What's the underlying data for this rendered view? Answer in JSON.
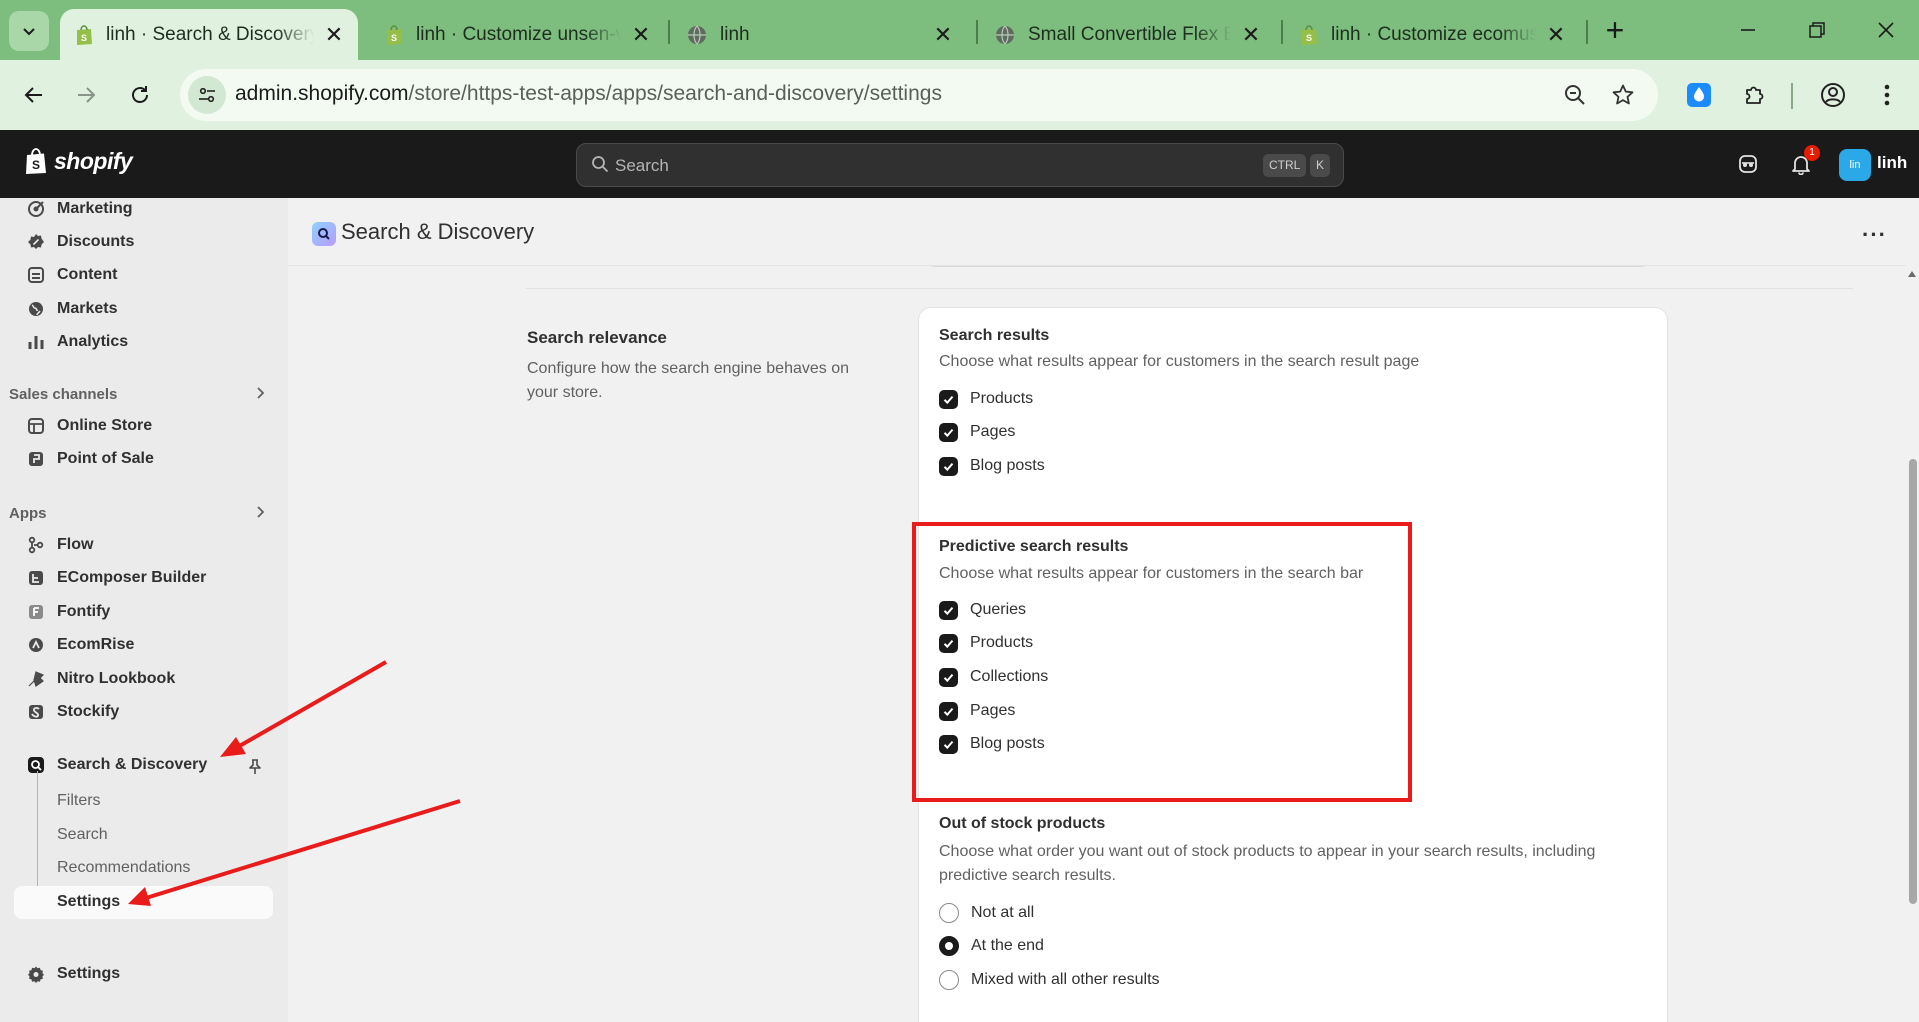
{
  "browser": {
    "tabs": [
      {
        "title": "linh · Search & Discovery",
        "icon": "shopify-bag-icon",
        "active": true
      },
      {
        "title": "linh · Customize unsen-v",
        "icon": "shopify-bag-icon",
        "active": false
      },
      {
        "title": "linh",
        "icon": "globe-icon",
        "active": false
      },
      {
        "title": "Small Convertible Flex Ba",
        "icon": "globe-icon",
        "active": false
      },
      {
        "title": "linh · Customize ecomus-",
        "icon": "shopify-bag-icon",
        "active": false
      }
    ],
    "close_glyph": "✕",
    "new_tab_glyph": "+",
    "url_host": "admin.shopify.com",
    "url_path": "/store/https-test-apps/apps/search-and-discovery/settings"
  },
  "shopify": {
    "logo_text": "shopify",
    "search_placeholder": "Search",
    "shortcut_keys": [
      "CTRL",
      "K"
    ],
    "notification_count": "1",
    "avatar_initials": "lin",
    "user_name": "linh"
  },
  "sidebar": {
    "top_items": [
      {
        "label": "Marketing",
        "icon": "marketing-target-icon"
      },
      {
        "label": "Discounts",
        "icon": "discount-badge-icon"
      },
      {
        "label": "Content",
        "icon": "content-image-icon"
      },
      {
        "label": "Markets",
        "icon": "globe-markets-icon"
      },
      {
        "label": "Analytics",
        "icon": "bar-chart-icon"
      }
    ],
    "sales_channels_heading": "Sales channels",
    "sales_channels": [
      {
        "label": "Online Store",
        "icon": "store-icon"
      },
      {
        "label": "Point of Sale",
        "icon": "pos-bag-icon"
      }
    ],
    "apps_heading": "Apps",
    "apps": [
      {
        "label": "Flow",
        "icon": "flow-app-icon"
      },
      {
        "label": "EComposer Builder",
        "icon": "ecomposer-app-icon"
      },
      {
        "label": "Fontify",
        "icon": "fontify-app-icon"
      },
      {
        "label": "EcomRise",
        "icon": "ecomrise-app-icon"
      },
      {
        "label": "Nitro Lookbook",
        "icon": "nitro-app-icon"
      },
      {
        "label": "Stockify",
        "icon": "stockify-app-icon"
      }
    ],
    "active_app": "Search & Discovery",
    "sub_items": [
      "Filters",
      "Search",
      "Recommendations",
      "Settings"
    ],
    "bottom_settings": "Settings"
  },
  "page": {
    "title": "Search & Discovery",
    "more_glyph": "···",
    "section_title": "Search relevance",
    "section_desc": "Configure how the search engine behaves on your store.",
    "search_results": {
      "title": "Search results",
      "desc": "Choose what results appear for customers in the search result page",
      "options": [
        {
          "label": "Products",
          "checked": true
        },
        {
          "label": "Pages",
          "checked": true
        },
        {
          "label": "Blog posts",
          "checked": true
        }
      ]
    },
    "predictive": {
      "title": "Predictive search results",
      "desc": "Choose what results appear for customers in the search bar",
      "options": [
        {
          "label": "Queries",
          "checked": true
        },
        {
          "label": "Products",
          "checked": true
        },
        {
          "label": "Collections",
          "checked": true
        },
        {
          "label": "Pages",
          "checked": true
        },
        {
          "label": "Blog posts",
          "checked": true
        }
      ]
    },
    "out_of_stock": {
      "title": "Out of stock products",
      "desc": "Choose what order you want out of stock products to appear in your search results, including predictive search results.",
      "options": [
        {
          "label": "Not at all",
          "selected": false
        },
        {
          "label": "At the end",
          "selected": true
        },
        {
          "label": "Mixed with all other results",
          "selected": false
        }
      ]
    }
  },
  "annotation": {
    "highlight_color": "#ea1b1b",
    "arrow_color": "#ea1b1b"
  }
}
